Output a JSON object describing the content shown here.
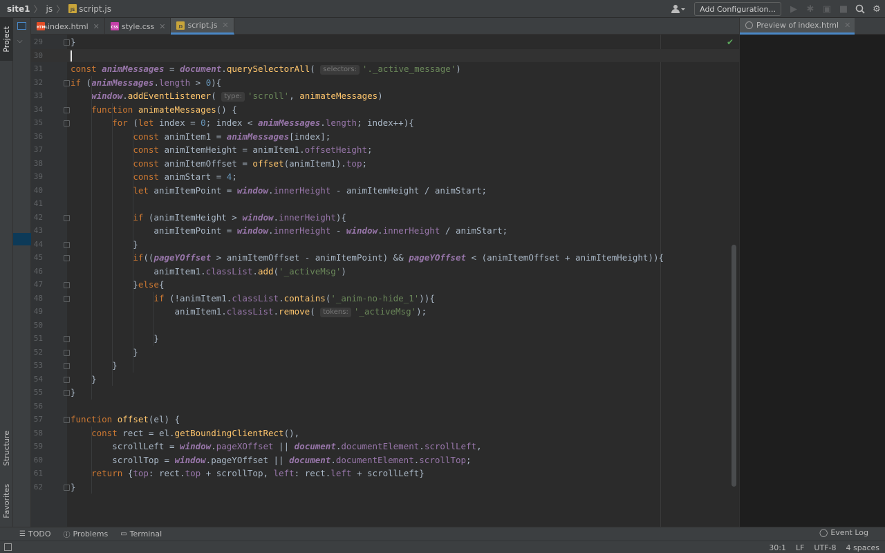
{
  "breadcrumb": {
    "project": "site1",
    "folder": "js",
    "file": "script.js"
  },
  "toolbar": {
    "add_config_label": "Add Configuration..."
  },
  "left_stripe": {
    "project": "Project",
    "structure": "Structure",
    "favorites": "Favorites"
  },
  "editor_tabs": [
    {
      "label": "index.html",
      "type": "HTML",
      "color": "#e44d26"
    },
    {
      "label": "style.css",
      "type": "CSS",
      "color": "#c53fa9"
    },
    {
      "label": "script.js",
      "type": "JS",
      "color": "#c9a53a",
      "active": true
    }
  ],
  "preview_tab": {
    "label": "Preview of index.html"
  },
  "code": {
    "lines": [
      {
        "n": "29",
        "text": "}"
      },
      {
        "n": "30",
        "text": ""
      },
      {
        "n": "31",
        "text": "const animMessages = document.querySelectorAll( selectors: '._active_message')"
      },
      {
        "n": "32",
        "text": "if (animMessages.length > 0){"
      },
      {
        "n": "33",
        "text": "    window.addEventListener( type: 'scroll', animateMessages)"
      },
      {
        "n": "34",
        "text": "    function animateMessages() {"
      },
      {
        "n": "35",
        "text": "        for (let index = 0; index < animMessages.length; index++){"
      },
      {
        "n": "36",
        "text": "            const animItem1 = animMessages[index];"
      },
      {
        "n": "37",
        "text": "            const animItemHeight = animItem1.offsetHeight;"
      },
      {
        "n": "38",
        "text": "            const animItemOffset = offset(animItem1).top;"
      },
      {
        "n": "39",
        "text": "            const animStart = 4;"
      },
      {
        "n": "40",
        "text": "            let animItemPoint = window.innerHeight - animItemHeight / animStart;"
      },
      {
        "n": "41",
        "text": ""
      },
      {
        "n": "42",
        "text": "            if (animItemHeight > window.innerHeight){"
      },
      {
        "n": "43",
        "text": "                animItemPoint = window.innerHeight - window.innerHeight / animStart;"
      },
      {
        "n": "44",
        "text": "            }"
      },
      {
        "n": "45",
        "text": "            if((pageYOffset > animItemOffset - animItemPoint) && pageYOffset < (animItemOffset + animItemHeight)){"
      },
      {
        "n": "46",
        "text": "                animItem1.classList.add('_activeMsg')"
      },
      {
        "n": "47",
        "text": "            }else{"
      },
      {
        "n": "48",
        "text": "                if (!animItem1.classList.contains('_anim-no-hide_1')){"
      },
      {
        "n": "49",
        "text": "                    animItem1.classList.remove( tokens: '_activeMsg');"
      },
      {
        "n": "50",
        "text": ""
      },
      {
        "n": "51",
        "text": "                }"
      },
      {
        "n": "52",
        "text": "            }"
      },
      {
        "n": "53",
        "text": "        }"
      },
      {
        "n": "54",
        "text": "    }"
      },
      {
        "n": "55",
        "text": "}"
      },
      {
        "n": "56",
        "text": ""
      },
      {
        "n": "57",
        "text": "function offset(el) {"
      },
      {
        "n": "58",
        "text": "    const rect = el.getBoundingClientRect(),"
      },
      {
        "n": "59",
        "text": "        scrollLeft = window.pageXOffset || document.documentElement.scrollLeft,"
      },
      {
        "n": "60",
        "text": "        scrollTop = window.pageYOffset || document.documentElement.scrollTop;"
      },
      {
        "n": "61",
        "text": "    return {top: rect.top + scrollTop, left: rect.left + scrollLeft}"
      },
      {
        "n": "62",
        "text": "}"
      }
    ]
  },
  "tool_windows": {
    "todo": "TODO",
    "problems": "Problems",
    "terminal": "Terminal",
    "event_log": "Event Log"
  },
  "status": {
    "position": "30:1",
    "line_sep": "LF",
    "encoding": "UTF-8",
    "indent": "4 spaces"
  },
  "colors": {
    "keyword": "#cc7832",
    "global": "#9876aa",
    "function": "#ffc66d",
    "string": "#6a8759",
    "number": "#6897bb",
    "accent": "#4a88c7"
  }
}
